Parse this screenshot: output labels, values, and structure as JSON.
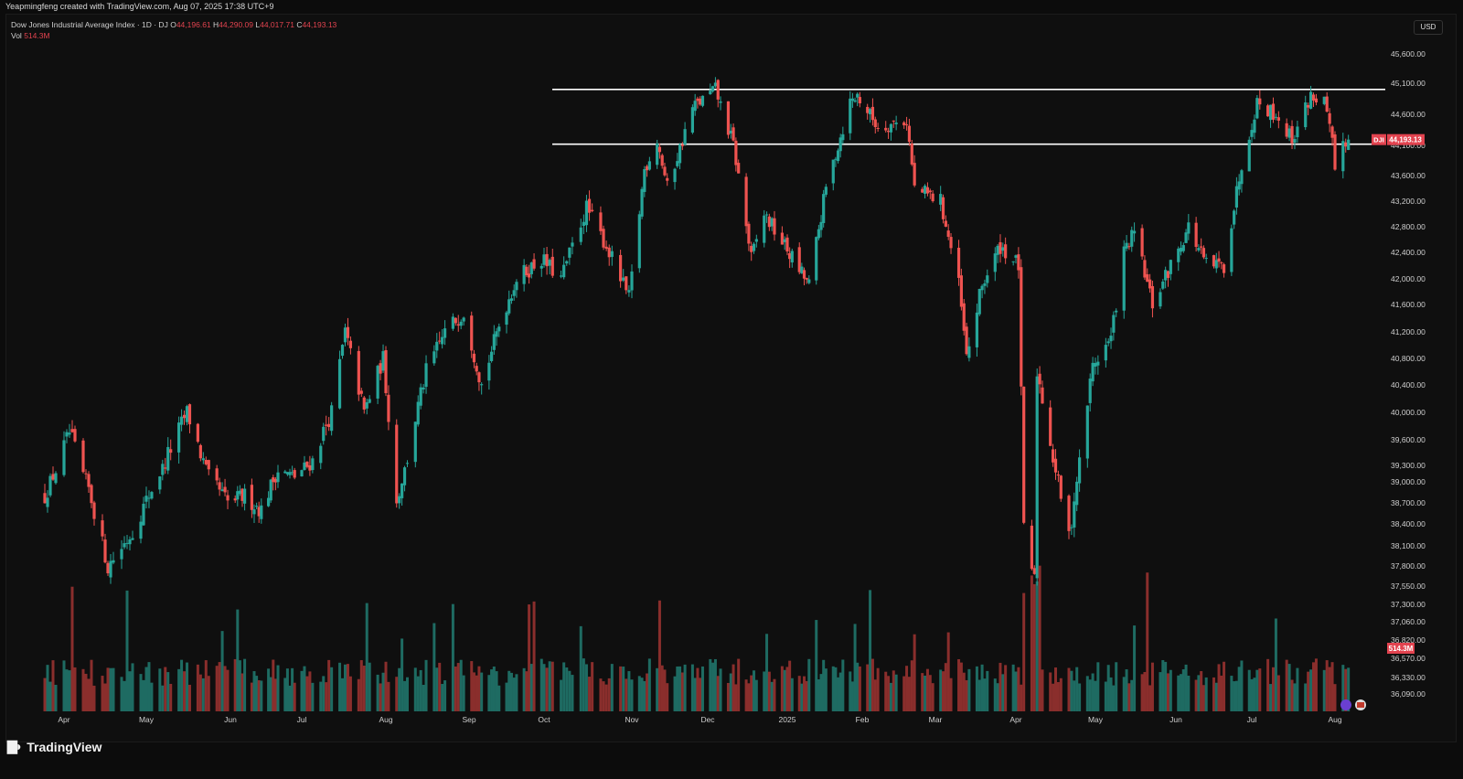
{
  "header": {
    "credit": "Yeapmingfeng created with TradingView.com, Aug 07, 2025 17:38 UTC+9",
    "symbol_title": "Dow Jones Industrial Average Index · 1D · DJ",
    "ohlc": {
      "open_label": "O",
      "open": "44,196.61",
      "high_label": "H",
      "high": "44,290.09",
      "low_label": "L",
      "low": "44,017.71",
      "close_label": "C",
      "close": "44,193.13"
    },
    "vol_label": "Vol",
    "vol_value": "514.3M",
    "currency_button": "USD"
  },
  "price_tag": {
    "symbol": "DJI",
    "value": "44,193.13"
  },
  "volume_tag": "514.3M",
  "brand": "TradingView",
  "colors": {
    "up": "#26a69a",
    "down": "#ef5350",
    "vol_up": "#1e6b62",
    "vol_down": "#8a2e2c",
    "background": "#0f0f0f",
    "level_line": "#ffffff",
    "tag": "#e2434f"
  },
  "chart_data": {
    "type": "candlestick",
    "title": "Dow Jones Industrial Average Index · 1D · DJ",
    "price_axis_ticks": [
      "45,600.00",
      "45,100.00",
      "44,600.00",
      "44,100.00",
      "43,600.00",
      "43,200.00",
      "42,800.00",
      "42,400.00",
      "42,000.00",
      "41,600.00",
      "41,200.00",
      "40,800.00",
      "40,400.00",
      "40,000.00",
      "39,600.00",
      "39,300.00",
      "39,000.00",
      "38,700.00",
      "38,400.00",
      "38,100.00",
      "37,800.00",
      "37,550.00",
      "37,300.00",
      "37,060.00",
      "36,820.00",
      "36,570.00",
      "36,330.00",
      "36,090.00"
    ],
    "time_axis_ticks": [
      "Apr",
      "May",
      "Jun",
      "Jul",
      "Aug",
      "Sep",
      "Oct",
      "Nov",
      "Dec",
      "2025",
      "Feb",
      "Mar",
      "Apr",
      "May",
      "Jun",
      "Jul",
      "Aug"
    ],
    "horizontal_levels": [
      45000,
      44120
    ],
    "last_close": 44193.13,
    "last_volume": "514.3M",
    "anchor_prices": [
      {
        "date": "2024-03-25",
        "close": 38800
      },
      {
        "date": "2024-04-03",
        "close": 39700
      },
      {
        "date": "2024-04-10",
        "close": 38900
      },
      {
        "date": "2024-04-17",
        "close": 37800
      },
      {
        "date": "2024-04-26",
        "close": 38300
      },
      {
        "date": "2024-05-03",
        "close": 38900
      },
      {
        "date": "2024-05-10",
        "close": 39500
      },
      {
        "date": "2024-05-16",
        "close": 40000
      },
      {
        "date": "2024-05-24",
        "close": 39100
      },
      {
        "date": "2024-05-31",
        "close": 38700
      },
      {
        "date": "2024-06-07",
        "close": 38800
      },
      {
        "date": "2024-06-14",
        "close": 38600
      },
      {
        "date": "2024-06-21",
        "close": 39200
      },
      {
        "date": "2024-06-28",
        "close": 39100
      },
      {
        "date": "2024-07-05",
        "close": 39350
      },
      {
        "date": "2024-07-12",
        "close": 40000
      },
      {
        "date": "2024-07-17",
        "close": 41200
      },
      {
        "date": "2024-07-24",
        "close": 40000
      },
      {
        "date": "2024-07-31",
        "close": 40800
      },
      {
        "date": "2024-08-05",
        "close": 38700
      },
      {
        "date": "2024-08-16",
        "close": 40600
      },
      {
        "date": "2024-08-23",
        "close": 41200
      },
      {
        "date": "2024-08-30",
        "close": 41500
      },
      {
        "date": "2024-09-06",
        "close": 40400
      },
      {
        "date": "2024-09-13",
        "close": 41300
      },
      {
        "date": "2024-09-20",
        "close": 42000
      },
      {
        "date": "2024-09-30",
        "close": 42300
      },
      {
        "date": "2024-10-07",
        "close": 42000
      },
      {
        "date": "2024-10-16",
        "close": 43100
      },
      {
        "date": "2024-10-23",
        "close": 42500
      },
      {
        "date": "2024-10-31",
        "close": 41700
      },
      {
        "date": "2024-11-06",
        "close": 43700
      },
      {
        "date": "2024-11-11",
        "close": 44200
      },
      {
        "date": "2024-11-15",
        "close": 43400
      },
      {
        "date": "2024-11-25",
        "close": 44700
      },
      {
        "date": "2024-12-04",
        "close": 45000
      },
      {
        "date": "2024-12-11",
        "close": 44100
      },
      {
        "date": "2024-12-18",
        "close": 42300
      },
      {
        "date": "2024-12-23",
        "close": 43000
      },
      {
        "date": "2024-12-31",
        "close": 42500
      },
      {
        "date": "2025-01-10",
        "close": 41900
      },
      {
        "date": "2025-01-17",
        "close": 43400
      },
      {
        "date": "2025-01-27",
        "close": 44800
      },
      {
        "date": "2025-01-30",
        "close": 44900
      },
      {
        "date": "2025-02-07",
        "close": 44400
      },
      {
        "date": "2025-02-18",
        "close": 44500
      },
      {
        "date": "2025-02-21",
        "close": 43400
      },
      {
        "date": "2025-03-03",
        "close": 43200
      },
      {
        "date": "2025-03-10",
        "close": 41900
      },
      {
        "date": "2025-03-13",
        "close": 40800
      },
      {
        "date": "2025-03-19",
        "close": 41900
      },
      {
        "date": "2025-03-26",
        "close": 42500
      },
      {
        "date": "2025-04-02",
        "close": 42200
      },
      {
        "date": "2025-04-04",
        "close": 38300
      },
      {
        "date": "2025-04-08",
        "close": 37600
      },
      {
        "date": "2025-04-09",
        "close": 40600
      },
      {
        "date": "2025-04-21",
        "close": 38200
      },
      {
        "date": "2025-04-30",
        "close": 40700
      },
      {
        "date": "2025-05-07",
        "close": 41100
      },
      {
        "date": "2025-05-12",
        "close": 42400
      },
      {
        "date": "2025-05-16",
        "close": 42700
      },
      {
        "date": "2025-05-23",
        "close": 41600
      },
      {
        "date": "2025-06-06",
        "close": 42800
      },
      {
        "date": "2025-06-13",
        "close": 42200
      },
      {
        "date": "2025-06-20",
        "close": 42200
      },
      {
        "date": "2025-06-27",
        "close": 43800
      },
      {
        "date": "2025-07-03",
        "close": 44800
      },
      {
        "date": "2025-07-10",
        "close": 44600
      },
      {
        "date": "2025-07-16",
        "close": 44200
      },
      {
        "date": "2025-07-23",
        "close": 44900
      },
      {
        "date": "2025-07-28",
        "close": 44800
      },
      {
        "date": "2025-07-31",
        "close": 44100
      },
      {
        "date": "2025-08-01",
        "close": 43600
      },
      {
        "date": "2025-08-04",
        "close": 44170
      },
      {
        "date": "2025-08-06",
        "close": 44193.13
      }
    ]
  }
}
